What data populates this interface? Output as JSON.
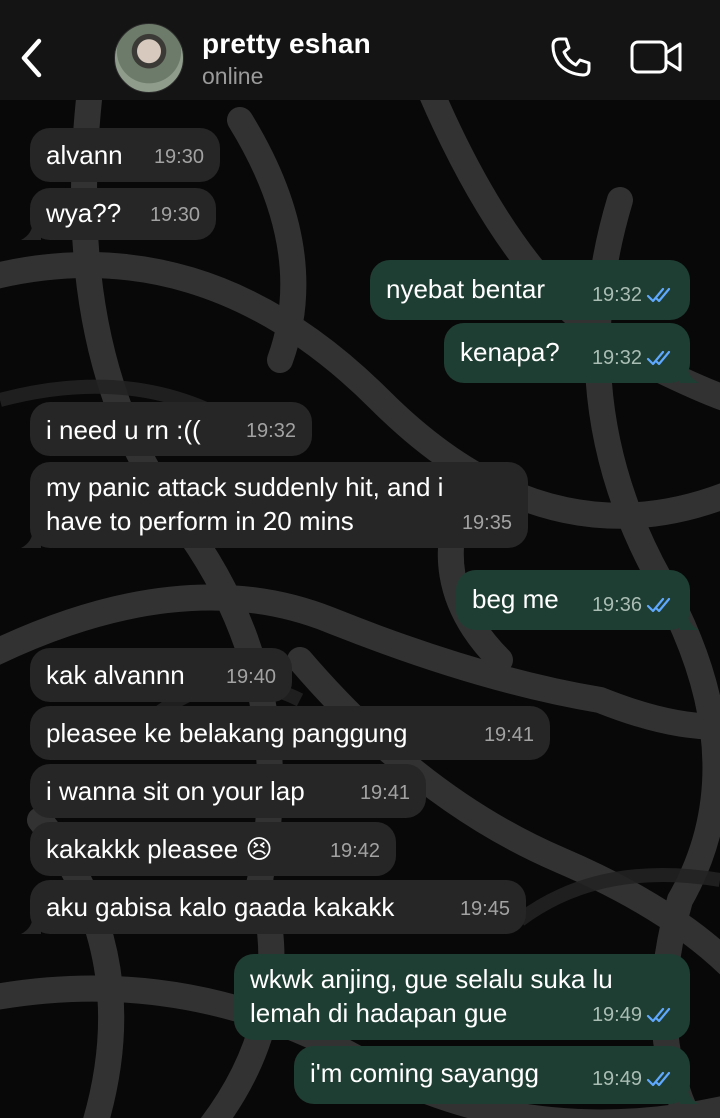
{
  "header": {
    "contact_name": "pretty eshan",
    "status": "online",
    "back_icon": "chevron-left-icon",
    "call_icon": "phone-icon",
    "video_icon": "video-camera-icon"
  },
  "colors": {
    "header_bg": "#141414",
    "incoming_bubble": "#262626",
    "outgoing_bubble": "#1f3e33",
    "read_ticks": "#5fa8ff"
  },
  "messages": [
    {
      "direction": "in",
      "text": "alvann",
      "time": "19:30"
    },
    {
      "direction": "in",
      "text": "wya??",
      "time": "19:30"
    },
    {
      "direction": "out",
      "text": "nyebat bentar",
      "time": "19:32",
      "read": true
    },
    {
      "direction": "out",
      "text": "kenapa?",
      "time": "19:32",
      "read": true
    },
    {
      "direction": "in",
      "text": "i need u rn :((",
      "time": "19:32"
    },
    {
      "direction": "in",
      "text": "my panic attack suddenly hit, and i have to perform in 20 mins",
      "time": "19:35"
    },
    {
      "direction": "out",
      "text": "beg me",
      "time": "19:36",
      "read": true
    },
    {
      "direction": "in",
      "text": "kak alvannn",
      "time": "19:40"
    },
    {
      "direction": "in",
      "text": "pleasee ke belakang panggung",
      "time": "19:41"
    },
    {
      "direction": "in",
      "text": "i wanna sit on your lap",
      "time": "19:41"
    },
    {
      "direction": "in",
      "text": "kakakkk pleasee 😣",
      "time": "19:42"
    },
    {
      "direction": "in",
      "text": "aku gabisa kalo gaada kakakk",
      "time": "19:45"
    },
    {
      "direction": "out",
      "text": "wkwk anjing, gue selalu suka lu lemah di hadapan gue",
      "time": "19:49",
      "read": true
    },
    {
      "direction": "out",
      "text": "i'm coming sayangg",
      "time": "19:49",
      "read": true
    }
  ]
}
